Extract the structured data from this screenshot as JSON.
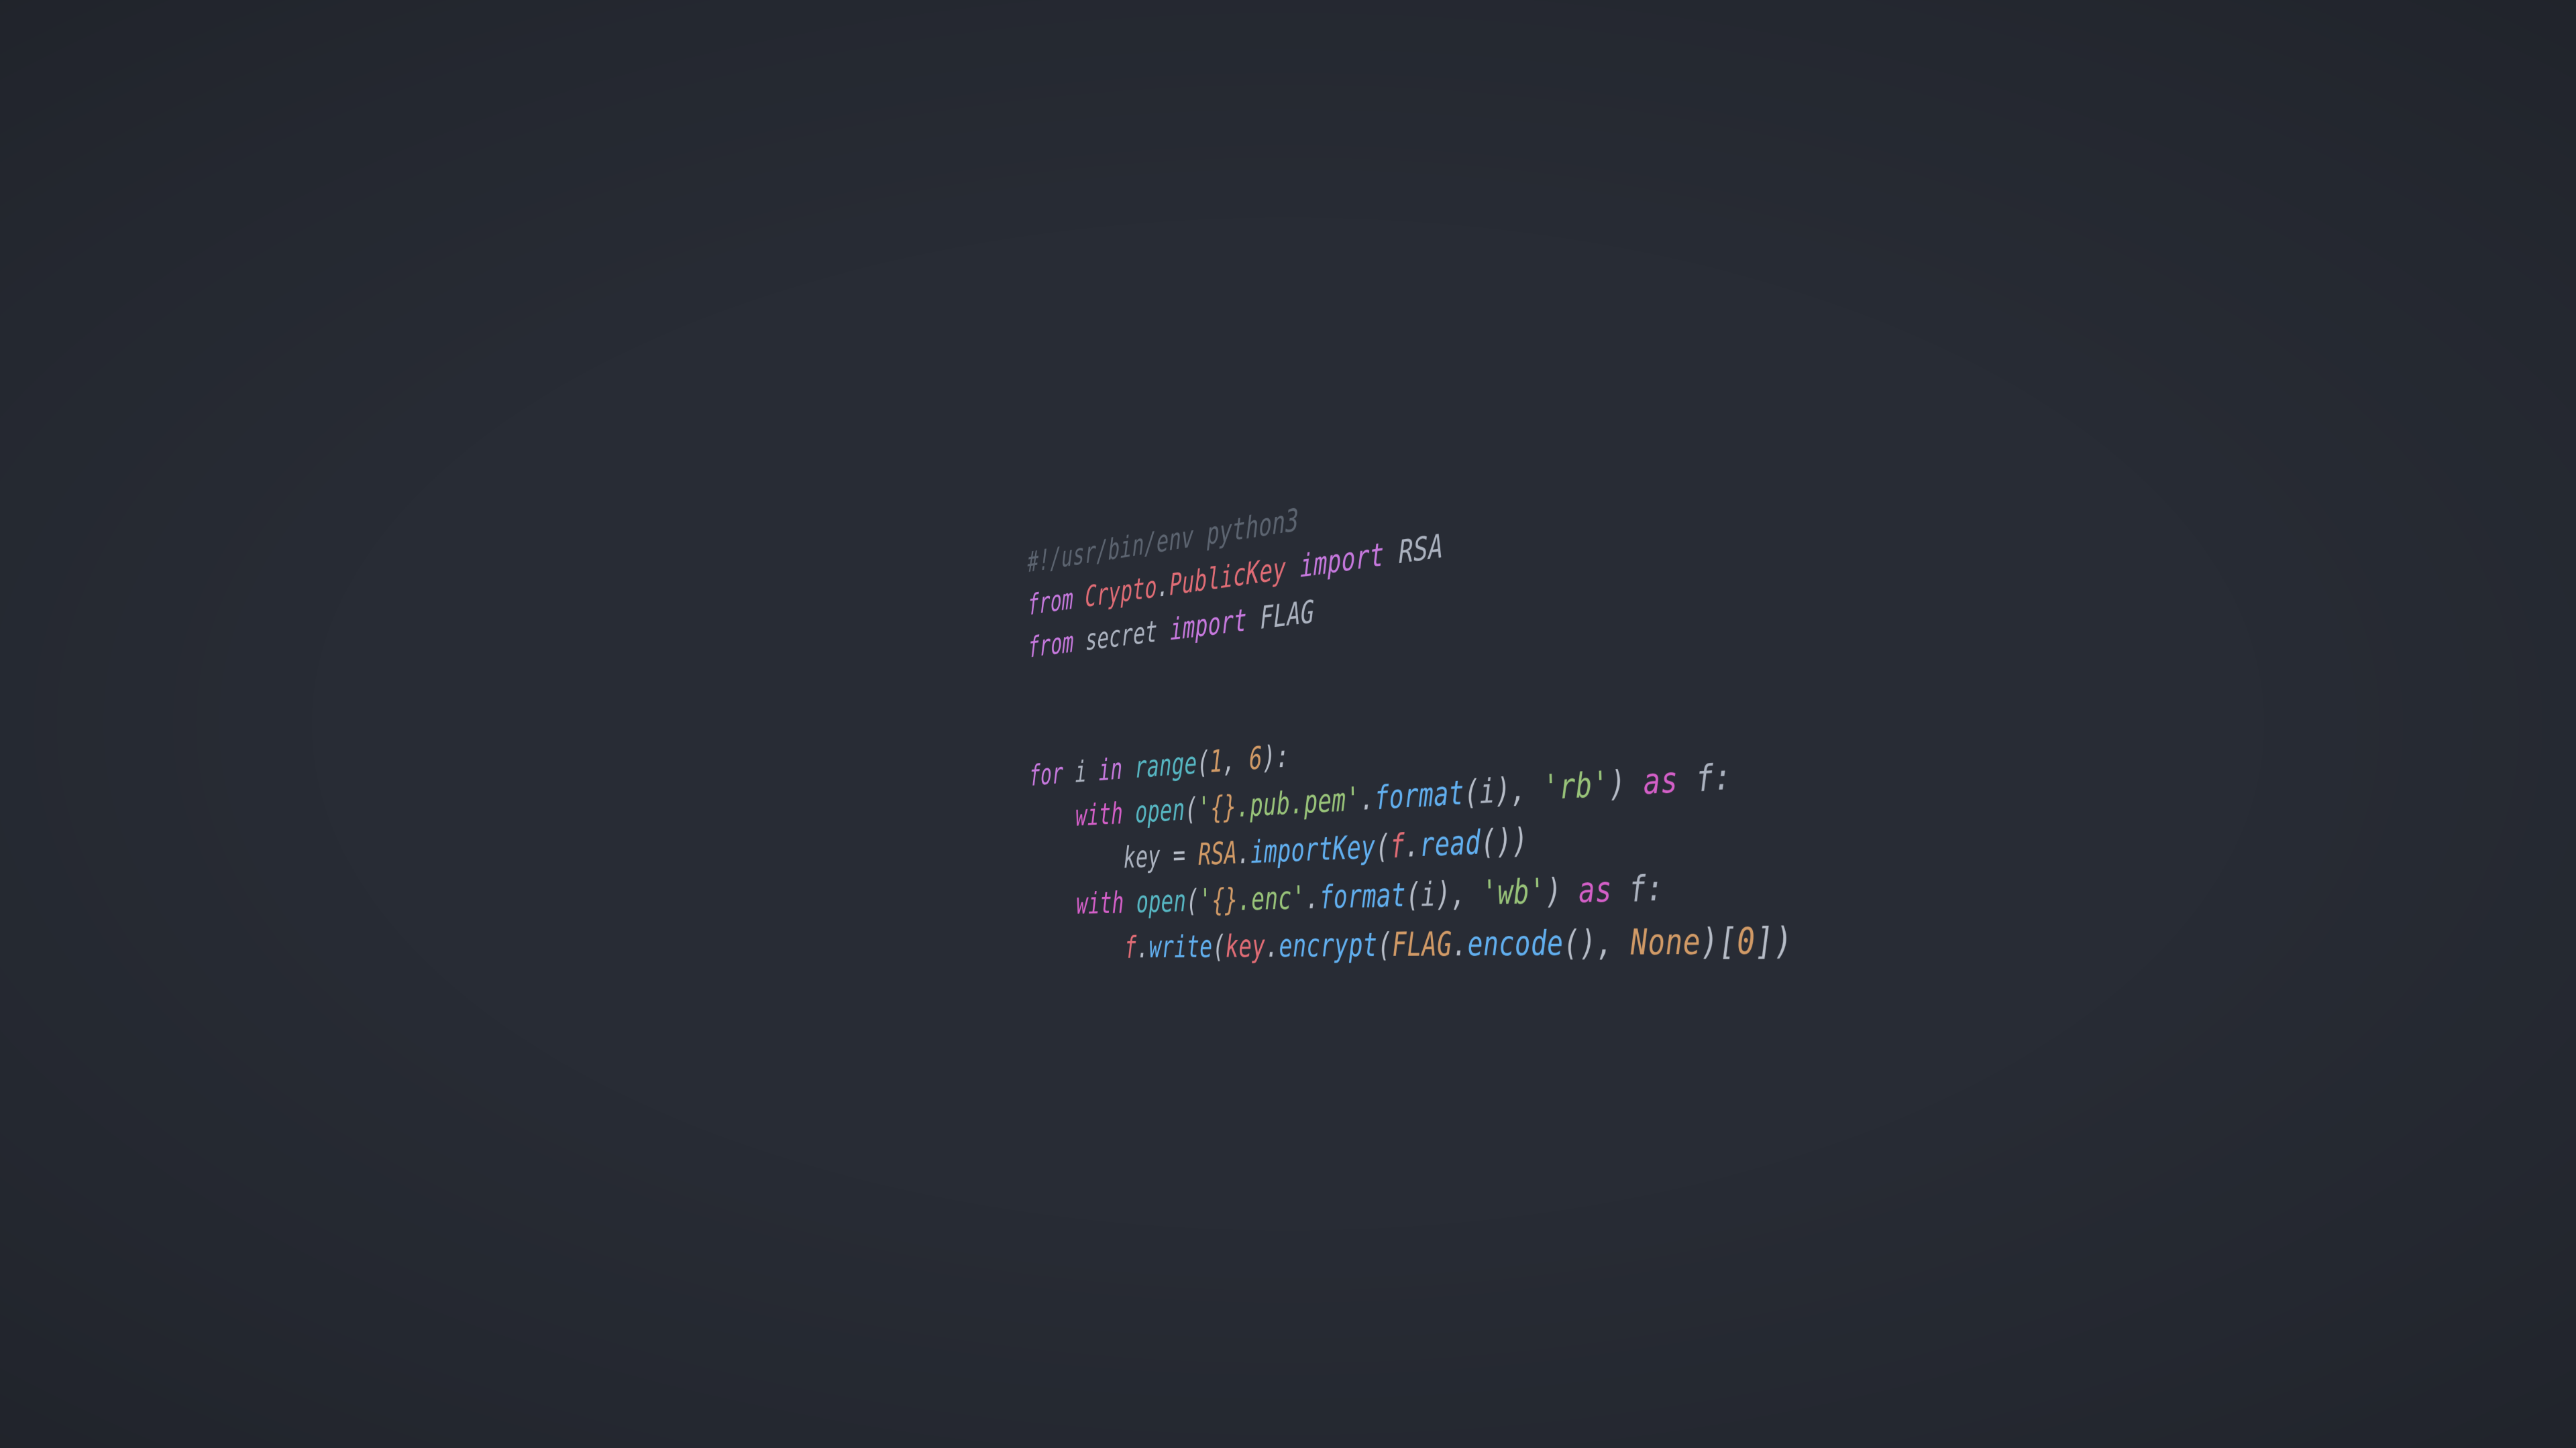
{
  "wallpaper": {
    "title": "python3 RSA encryption script wallpaper",
    "background_color": "#282c35",
    "language": "python",
    "theme": "one-dark"
  },
  "palette": {
    "background": "#282c35",
    "comment": "#5c6470",
    "keyword": "#c678dd",
    "keyword_alt": "#d45fc8",
    "class_name": "#e06c75",
    "variable": "#e06c75",
    "plain_text": "#abb2bf",
    "punctuation": "#b6bcc7",
    "builtin": "#56b6c2",
    "function": "#61afef",
    "string": "#98c379",
    "number": "#d19a66",
    "constant": "#d19a66",
    "format_brace": "#d19a66"
  },
  "code": {
    "full_text": "#!/usr/bin/env python3\nfrom Crypto.PublicKey import RSA\nfrom secret import FLAG\n\n\nfor i in range(1, 6):\n    with open('{}.pub.pem'.format(i), 'rb') as f:\n        key = RSA.importKey(f.read())\n    with open('{}.enc'.format(i), 'wb') as f:\n        f.write(key.encrypt(FLAG.encode(), None)[0])",
    "lines": [
      {
        "n": 1,
        "indent": 0,
        "text": "#!/usr/bin/env python3",
        "tokens": [
          {
            "t": "#!/usr/bin/env python3",
            "c": "comment"
          }
        ]
      },
      {
        "n": 2,
        "indent": 0,
        "text": "from Crypto.PublicKey import RSA",
        "tokens": [
          {
            "t": "from",
            "c": "keyword"
          },
          {
            "t": " ",
            "c": "plain"
          },
          {
            "t": "Crypto",
            "c": "class_name"
          },
          {
            "t": ".",
            "c": "punctuation"
          },
          {
            "t": "PublicKey",
            "c": "class_name"
          },
          {
            "t": " ",
            "c": "plain"
          },
          {
            "t": "import",
            "c": "keyword"
          },
          {
            "t": " ",
            "c": "plain"
          },
          {
            "t": "RSA",
            "c": "plain"
          }
        ]
      },
      {
        "n": 3,
        "indent": 0,
        "text": "from secret import FLAG",
        "tokens": [
          {
            "t": "from",
            "c": "keyword"
          },
          {
            "t": " ",
            "c": "plain"
          },
          {
            "t": "secret",
            "c": "plain"
          },
          {
            "t": " ",
            "c": "plain"
          },
          {
            "t": "import",
            "c": "keyword"
          },
          {
            "t": " ",
            "c": "plain"
          },
          {
            "t": "FLAG",
            "c": "plain"
          }
        ]
      },
      {
        "n": 4,
        "indent": 0,
        "text": "",
        "tokens": []
      },
      {
        "n": 5,
        "indent": 0,
        "text": "",
        "tokens": []
      },
      {
        "n": 6,
        "indent": 0,
        "text": "for i in range(1, 6):",
        "tokens": [
          {
            "t": "for",
            "c": "keyword"
          },
          {
            "t": " ",
            "c": "plain"
          },
          {
            "t": "i",
            "c": "plain"
          },
          {
            "t": " ",
            "c": "plain"
          },
          {
            "t": "in",
            "c": "keyword"
          },
          {
            "t": " ",
            "c": "plain"
          },
          {
            "t": "range",
            "c": "builtin"
          },
          {
            "t": "(",
            "c": "punctuation"
          },
          {
            "t": "1",
            "c": "number"
          },
          {
            "t": ", ",
            "c": "punctuation"
          },
          {
            "t": "6",
            "c": "number"
          },
          {
            "t": "):",
            "c": "punctuation"
          }
        ]
      },
      {
        "n": 7,
        "indent": 4,
        "text": "    with open('{}.pub.pem'.format(i), 'rb') as f:",
        "tokens": [
          {
            "t": "with",
            "c": "keyword_alt"
          },
          {
            "t": " ",
            "c": "plain"
          },
          {
            "t": "open",
            "c": "builtin"
          },
          {
            "t": "(",
            "c": "punctuation"
          },
          {
            "t": "'",
            "c": "string"
          },
          {
            "t": "{}",
            "c": "format_brace"
          },
          {
            "t": ".pub.pem'",
            "c": "string"
          },
          {
            "t": ".",
            "c": "punctuation"
          },
          {
            "t": "format",
            "c": "function"
          },
          {
            "t": "(",
            "c": "punctuation"
          },
          {
            "t": "i",
            "c": "plain"
          },
          {
            "t": "), ",
            "c": "punctuation"
          },
          {
            "t": "'rb'",
            "c": "string"
          },
          {
            "t": ")",
            "c": "punctuation"
          },
          {
            "t": " ",
            "c": "plain"
          },
          {
            "t": "as",
            "c": "keyword_alt"
          },
          {
            "t": " ",
            "c": "plain"
          },
          {
            "t": "f:",
            "c": "plain"
          }
        ]
      },
      {
        "n": 8,
        "indent": 8,
        "text": "        key = RSA.importKey(f.read())",
        "tokens": [
          {
            "t": "key",
            "c": "plain"
          },
          {
            "t": " = ",
            "c": "punctuation"
          },
          {
            "t": "RSA",
            "c": "constant"
          },
          {
            "t": ".",
            "c": "punctuation"
          },
          {
            "t": "importKey",
            "c": "function"
          },
          {
            "t": "(",
            "c": "punctuation"
          },
          {
            "t": "f",
            "c": "variable"
          },
          {
            "t": ".",
            "c": "punctuation"
          },
          {
            "t": "read",
            "c": "function"
          },
          {
            "t": "())",
            "c": "punctuation"
          }
        ]
      },
      {
        "n": 9,
        "indent": 4,
        "text": "    with open('{}.enc'.format(i), 'wb') as f:",
        "tokens": [
          {
            "t": "with",
            "c": "keyword_alt"
          },
          {
            "t": " ",
            "c": "plain"
          },
          {
            "t": "open",
            "c": "builtin"
          },
          {
            "t": "(",
            "c": "punctuation"
          },
          {
            "t": "'",
            "c": "string"
          },
          {
            "t": "{}",
            "c": "format_brace"
          },
          {
            "t": ".enc'",
            "c": "string"
          },
          {
            "t": ".",
            "c": "punctuation"
          },
          {
            "t": "format",
            "c": "function"
          },
          {
            "t": "(",
            "c": "punctuation"
          },
          {
            "t": "i",
            "c": "plain"
          },
          {
            "t": "), ",
            "c": "punctuation"
          },
          {
            "t": "'wb'",
            "c": "string"
          },
          {
            "t": ")",
            "c": "punctuation"
          },
          {
            "t": " ",
            "c": "plain"
          },
          {
            "t": "as",
            "c": "keyword_alt"
          },
          {
            "t": " ",
            "c": "plain"
          },
          {
            "t": "f:",
            "c": "plain"
          }
        ]
      },
      {
        "n": 10,
        "indent": 8,
        "text": "        f.write(key.encrypt(FLAG.encode(), None)[0])",
        "tokens": [
          {
            "t": "f",
            "c": "variable"
          },
          {
            "t": ".",
            "c": "punctuation"
          },
          {
            "t": "write",
            "c": "function"
          },
          {
            "t": "(",
            "c": "punctuation"
          },
          {
            "t": "key",
            "c": "variable"
          },
          {
            "t": ".",
            "c": "punctuation"
          },
          {
            "t": "encrypt",
            "c": "function"
          },
          {
            "t": "(",
            "c": "punctuation"
          },
          {
            "t": "FLAG",
            "c": "constant"
          },
          {
            "t": ".",
            "c": "punctuation"
          },
          {
            "t": "encode",
            "c": "function"
          },
          {
            "t": "(), ",
            "c": "punctuation"
          },
          {
            "t": "None",
            "c": "constant"
          },
          {
            "t": ")[",
            "c": "punctuation"
          },
          {
            "t": "0",
            "c": "number"
          },
          {
            "t": "])",
            "c": "punctuation"
          }
        ]
      }
    ]
  }
}
